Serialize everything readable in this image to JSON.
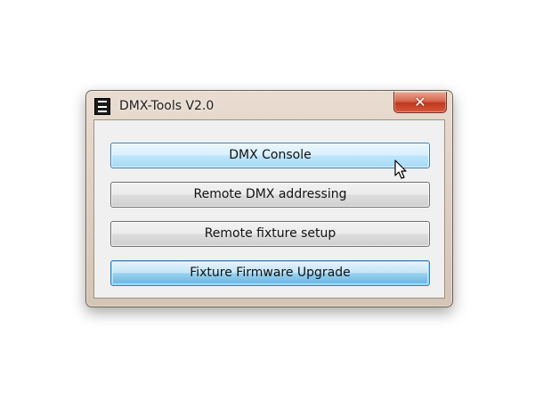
{
  "window": {
    "title": "DMX-Tools V2.0",
    "close_glyph": "✕"
  },
  "buttons": [
    {
      "label": "DMX Console",
      "state": "hover"
    },
    {
      "label": "Remote DMX addressing",
      "state": "normal"
    },
    {
      "label": "Remote fixture setup",
      "state": "normal"
    },
    {
      "label": "Fixture Firmware Upgrade",
      "state": "focused"
    }
  ],
  "icons": {
    "app": "app-logo-icon",
    "close": "close-icon",
    "cursor": "mouse-pointer-icon"
  },
  "colors": {
    "hover_accent": "#bee6fd",
    "focus_accent": "#68b3db",
    "close_red": "#c0391f"
  }
}
